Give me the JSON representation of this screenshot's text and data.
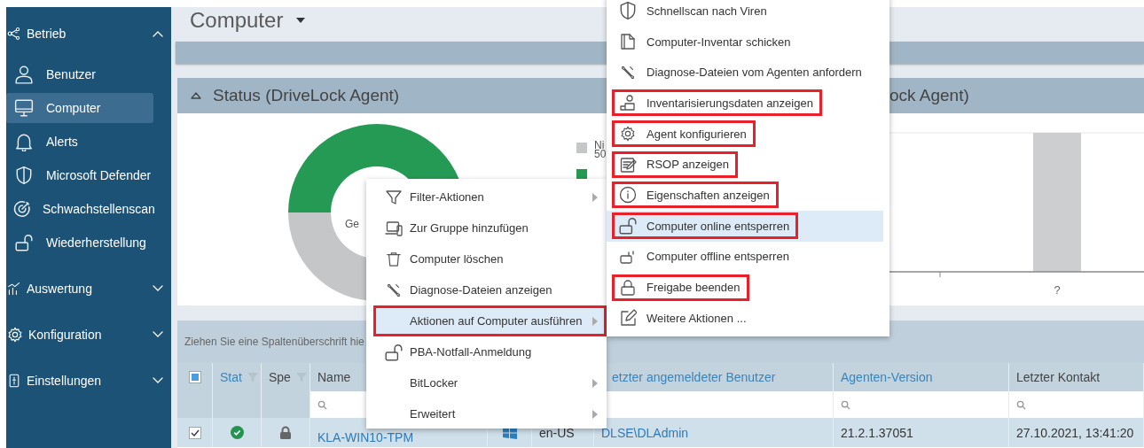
{
  "page": {
    "title": "Computer"
  },
  "sidebar": {
    "sections": [
      {
        "label": "Betrieb",
        "expanded": true,
        "items": [
          {
            "label": "Benutzer",
            "selected": false
          },
          {
            "label": "Computer",
            "selected": true
          },
          {
            "label": "Alerts",
            "selected": false
          },
          {
            "label": "Microsoft Defender",
            "selected": false
          },
          {
            "label": "Schwachstellenscan",
            "selected": false
          },
          {
            "label": "Wiederherstellung",
            "selected": false
          }
        ]
      },
      {
        "label": "Auswertung",
        "expanded": false
      },
      {
        "label": "Konfiguration",
        "expanded": false
      },
      {
        "label": "Einstellungen",
        "expanded": false
      }
    ]
  },
  "status_panel": {
    "title": "Status (DriveLock Agent)",
    "expanded": true,
    "donut_label": "Ge",
    "legend": [
      {
        "label": "Ni",
        "value": "50",
        "color": "#c4c6c8"
      },
      {
        "color": "#259a55"
      }
    ]
  },
  "version_panel": {
    "title": "ock Agent)",
    "x_label": "?"
  },
  "grid": {
    "group_hint": "Ziehen Sie eine Spaltenüberschrift hie",
    "select_all": {
      "indeterminate": true
    },
    "columns": [
      {
        "label": "Stat",
        "accent": true,
        "filter": true,
        "search": false
      },
      {
        "label": "Spe",
        "accent": false,
        "filter": true,
        "search": false
      },
      {
        "label": "Name",
        "accent": false,
        "filter": false,
        "search": true
      },
      {},
      {},
      {
        "label": "etzter angemeldeter Benutzer",
        "accent": true,
        "filter": false
      },
      {
        "label": "Agenten-Version",
        "accent": true,
        "filter": false,
        "search": true
      },
      {
        "label": "Letzter Kontakt",
        "accent": false,
        "filter": false,
        "search": true
      }
    ],
    "rows": [
      {
        "selected": true,
        "checked": true,
        "online": true,
        "locked": true,
        "name": "KLA-WIN10-TPM",
        "language": "en-US",
        "user": "DLSE\\DLAdmin",
        "version": "21.2.1.37051",
        "last_contact": "27.10.2021, 13:41:20"
      }
    ]
  },
  "context_menu": {
    "items": [
      {
        "label": "Filter-Aktionen",
        "submenu": true,
        "highlighted": false,
        "outlined": false
      },
      {
        "label": "Zur Gruppe hinzufügen",
        "submenu": false,
        "highlighted": false,
        "outlined": false
      },
      {
        "label": "Computer löschen",
        "submenu": false,
        "highlighted": false,
        "outlined": false
      },
      {
        "label": "Diagnose-Dateien anzeigen",
        "submenu": false,
        "highlighted": false,
        "outlined": false
      },
      {
        "label": "Aktionen auf Computer ausführen",
        "submenu": true,
        "highlighted": true,
        "outlined": true
      },
      {
        "label": "PBA-Notfall-Anmeldung",
        "submenu": false,
        "highlighted": false,
        "outlined": false
      },
      {
        "label": "BitLocker",
        "submenu": true,
        "highlighted": false,
        "outlined": false
      },
      {
        "label": "Erweitert",
        "submenu": true,
        "highlighted": false,
        "outlined": false
      }
    ]
  },
  "submenu": {
    "items": [
      {
        "label": "Schnellscan nach Viren",
        "highlighted": false,
        "outlined": false
      },
      {
        "label": "Computer-Inventar schicken",
        "highlighted": false,
        "outlined": false
      },
      {
        "label": "Diagnose-Dateien vom Agenten anfordern",
        "highlighted": false,
        "outlined": false
      },
      {
        "label": "Inventarisierungsdaten anzeigen",
        "highlighted": false,
        "outlined": true
      },
      {
        "label": "Agent konfigurieren",
        "highlighted": false,
        "outlined": true
      },
      {
        "label": "RSOP anzeigen",
        "highlighted": false,
        "outlined": true
      },
      {
        "label": "Eigenschaften anzeigen",
        "highlighted": false,
        "outlined": true
      },
      {
        "label": "Computer online entsperren",
        "highlighted": true,
        "outlined": true
      },
      {
        "label": "Computer offline entsperren",
        "highlighted": false,
        "outlined": false
      },
      {
        "label": "Freigabe beenden",
        "highlighted": false,
        "outlined": true
      },
      {
        "label": "Weitere Aktionen ...",
        "highlighted": false,
        "outlined": false
      }
    ]
  }
}
